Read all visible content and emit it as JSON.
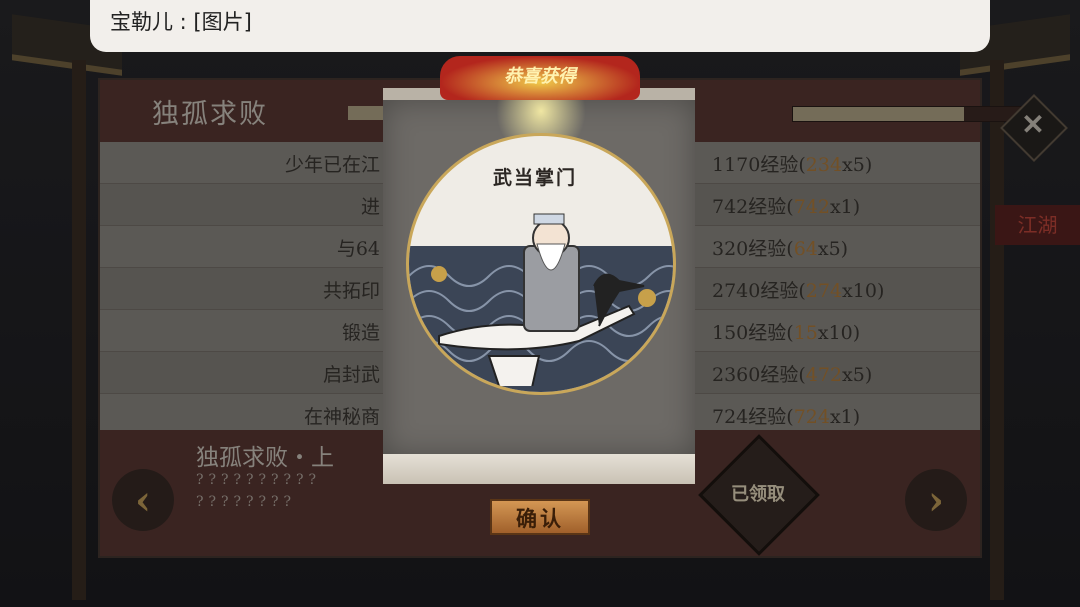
{
  "chat": {
    "text": "宝勒儿 : [图片]"
  },
  "panel": {
    "title": "独孤求败",
    "progress_fraction": 0.72,
    "rows": [
      {
        "task": "少年已在江",
        "exp": "1170经验(",
        "exp_hl": "234",
        "exp_mult": "x5)"
      },
      {
        "task": "进",
        "exp": "742经验(",
        "exp_hl": "742",
        "exp_mult": "x1)"
      },
      {
        "task": "与64",
        "exp": "320经验(",
        "exp_hl": "64",
        "exp_mult": "x5)"
      },
      {
        "task": "共拓印",
        "exp": "2740经验(",
        "exp_hl": "274",
        "exp_mult": "x10)"
      },
      {
        "task": "锻造",
        "exp": "150经验(",
        "exp_hl": "15",
        "exp_mult": "x10)"
      },
      {
        "task": "启封武",
        "exp": "2360经验(",
        "exp_hl": "472",
        "exp_mult": "x5)"
      },
      {
        "task": "在神秘商",
        "exp": "724经验(",
        "exp_hl": "724",
        "exp_mult": "x1)"
      }
    ],
    "footer_title": "独孤求败・上",
    "footer_line1": "??????????",
    "footer_line2": "????????",
    "claimed_label": "已领取",
    "side_tag": "江湖"
  },
  "reward": {
    "banner": "恭喜获得",
    "card_title": "武当掌门",
    "confirm_label": "确认"
  },
  "icons": {
    "prev": "chevron-left-icon",
    "next": "chevron-right-icon",
    "close": "close-icon"
  }
}
